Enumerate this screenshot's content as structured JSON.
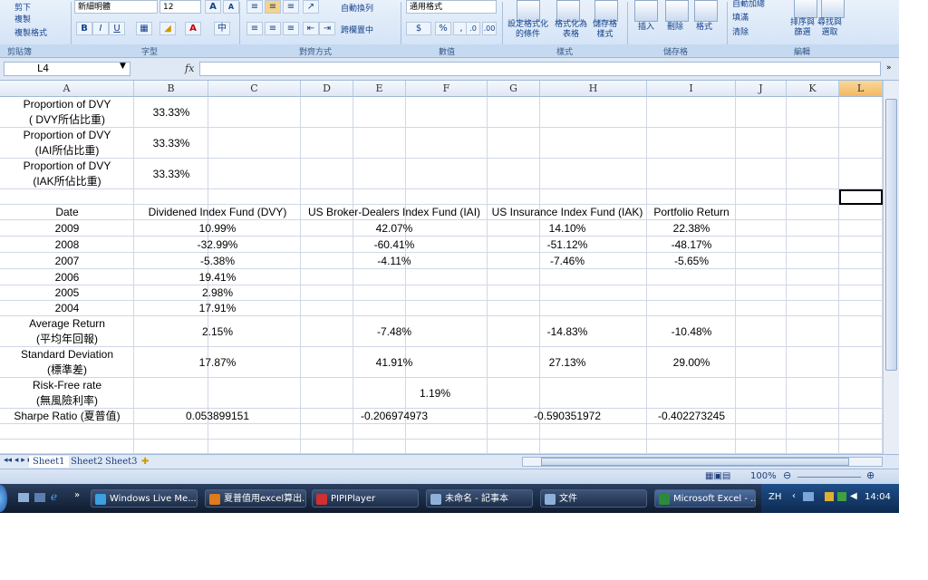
{
  "ribbon": {
    "clipboard": {
      "cut": "剪下",
      "copy": "複製",
      "format_painter": "複製格式",
      "label": "剪貼簿"
    },
    "font": {
      "name": "新細明體",
      "size": "12",
      "label": "字型",
      "grow": "A",
      "shrink": "A"
    },
    "alignment": {
      "wrap": "自動換列",
      "merge": "跨欄置中",
      "label": "對齊方式"
    },
    "number": {
      "format": "通用格式",
      "percent": "%",
      "comma": ",",
      "label": "數值"
    },
    "styles": {
      "cond": "設定格式化\n的條件",
      "table": "格式化為\n表格",
      "cell": "儲存格\n樣式",
      "label": "樣式"
    },
    "cells": {
      "insert": "插入",
      "delete": "刪除",
      "format": "格式",
      "label": "儲存格"
    },
    "editing": {
      "autosum": "自動加總",
      "fill": "填滿",
      "clear": "清除",
      "sort": "排序與\n篩選",
      "find": "尋找與\n選取",
      "label": "編輯"
    }
  },
  "formula_bar": {
    "name_box": "L4",
    "fx": "fx",
    "value": ""
  },
  "columns": [
    "A",
    "B",
    "C",
    "D",
    "E",
    "F",
    "G",
    "H",
    "I",
    "J",
    "K",
    "L"
  ],
  "selected_column": "L",
  "rows": [
    {
      "a": "Proportion of DVY\n( DVY所佔比重)",
      "b": "33.33%"
    },
    {
      "a": "Proportion of DVY\n(IAI所佔比重)",
      "b": "33.33%"
    },
    {
      "a": "Proportion of DVY\n(IAK所佔比重)",
      "b": "33.33%"
    },
    {
      "a": "",
      "b": ""
    }
  ],
  "table_header": {
    "date": "Date",
    "dvy": "Dividened Index Fund (DVY)",
    "iai": "US Broker-Dealers Index Fund (IAI)",
    "iak": "US Insurance Index Fund (IAK)",
    "portfolio": "Portfolio Return"
  },
  "yearly": [
    {
      "year": "2009",
      "dvy": "10.99%",
      "iai": "42.07%",
      "iak": "14.10%",
      "port": "22.38%"
    },
    {
      "year": "2008",
      "dvy": "-32.99%",
      "iai": "-60.41%",
      "iak": "-51.12%",
      "port": "-48.17%"
    },
    {
      "year": "2007",
      "dvy": "-5.38%",
      "iai": "-4.11%",
      "iak": "-7.46%",
      "port": "-5.65%"
    },
    {
      "year": "2006",
      "dvy": "19.41%",
      "iai": "",
      "iak": "",
      "port": ""
    },
    {
      "year": "2005",
      "dvy": "2.98%",
      "iai": "",
      "iak": "",
      "port": ""
    },
    {
      "year": "2004",
      "dvy": "17.91%",
      "iai": "",
      "iak": "",
      "port": ""
    }
  ],
  "stats": {
    "avg_label": "Average Return\n(平均年回報)",
    "avg": {
      "dvy": "2.15%",
      "iai": "-7.48%",
      "iak": "-14.83%",
      "port": "-10.48%"
    },
    "std_label": "Standard Deviation\n(標準差)",
    "std": {
      "dvy": "17.87%",
      "iai": "41.91%",
      "iak": "27.13%",
      "port": "29.00%"
    },
    "rf_label": "Risk-Free rate\n(無風險利率)",
    "rf": "1.19%",
    "sharpe_label": "Sharpe Ratio (夏普值)",
    "sharpe": {
      "dvy": "0.053899151",
      "iai": "-0.206974973",
      "iak": "-0.590351972",
      "port": "-0.402273245"
    }
  },
  "sheets": [
    "Sheet1",
    "Sheet2",
    "Sheet3"
  ],
  "active_sheet": "Sheet1",
  "status": {
    "zoom": "100%"
  },
  "taskbar": {
    "items": [
      {
        "label": "Windows Live Me...",
        "color": "#3aa0e0"
      },
      {
        "label": "夏普值用excel算出...",
        "color": "#e07a1a"
      },
      {
        "label": "PIPIPlayer",
        "color": "#d03030"
      },
      {
        "label": "未命名 - 記事本",
        "color": "#8fb0d8"
      },
      {
        "label": "文件",
        "color": "#8fb0d8"
      },
      {
        "label": "Microsoft Excel - ...",
        "color": "#2d8a3a"
      }
    ],
    "lang": "ZH",
    "time": "14:04"
  }
}
